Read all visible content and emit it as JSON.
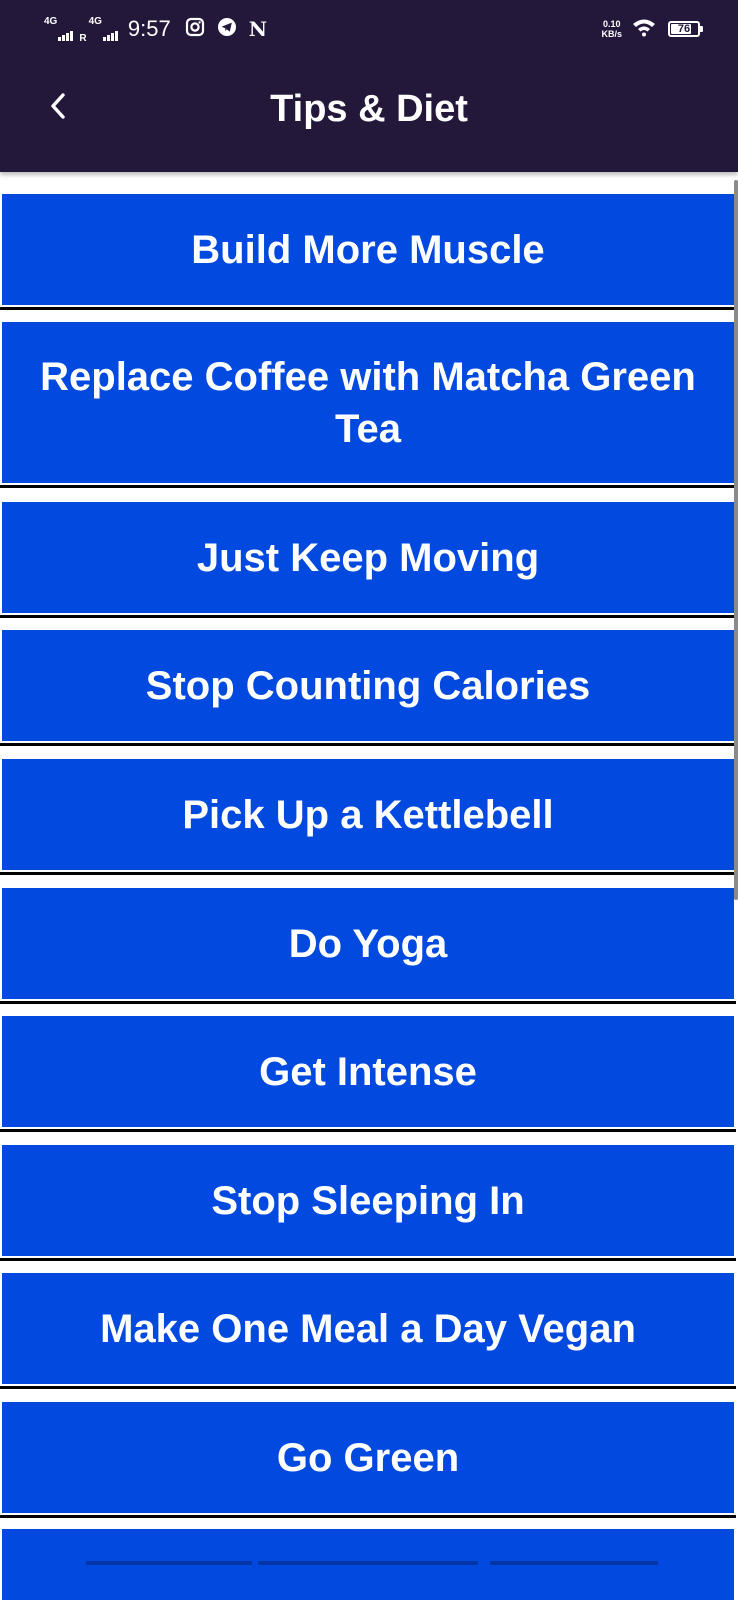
{
  "status_bar": {
    "network_1": "4G",
    "roaming": "R",
    "network_2": "4G",
    "time": "9:57",
    "net_speed_value": "0.10",
    "net_speed_unit": "KB/s",
    "battery_level": "76",
    "notification_n": "N",
    "icons": [
      "instagram-icon",
      "telegram-icon",
      "n-notification-icon",
      "wifi-icon",
      "battery-icon"
    ]
  },
  "app_bar": {
    "title": "Tips & Diet",
    "back_icon": "chevron-left-icon"
  },
  "colors": {
    "app_bar_bg": "#23183a",
    "tip_button_bg": "#0249e0",
    "tip_text": "#ffffff",
    "divider": "#000000"
  },
  "tips": [
    {
      "label": "Build More Muscle"
    },
    {
      "label": "Replace Coffee with Matcha Green Tea"
    },
    {
      "label": "Just Keep Moving"
    },
    {
      "label": "Stop Counting Calories"
    },
    {
      "label": "Pick Up a Kettlebell"
    },
    {
      "label": "Do Yoga"
    },
    {
      "label": "Get Intense"
    },
    {
      "label": "Stop Sleeping In"
    },
    {
      "label": "Make One Meal a Day Vegan"
    },
    {
      "label": "Go Green"
    }
  ]
}
